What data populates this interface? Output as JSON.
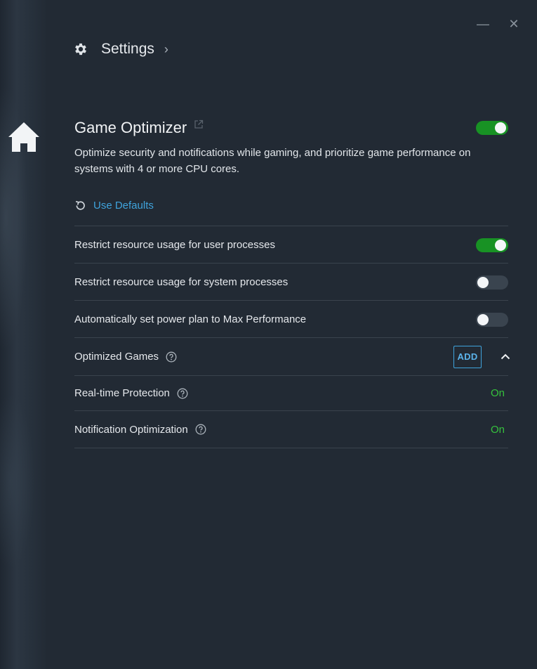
{
  "window": {
    "minimize_glyph": "—",
    "close_glyph": "✕"
  },
  "header": {
    "title": "Settings",
    "chevron": "›"
  },
  "section": {
    "title": "Game Optimizer",
    "description": "Optimize security and notifications while gaming, and prioritize game performance on systems with 4 or more CPU cores.",
    "enabled": true,
    "use_defaults_label": "Use Defaults"
  },
  "rows": [
    {
      "label": "Restrict resource usage for user processes",
      "toggle": true
    },
    {
      "label": "Restrict resource usage for system processes",
      "toggle": false
    },
    {
      "label": "Automatically set power plan to Max Performance",
      "toggle": false
    }
  ],
  "optimized_games": {
    "label": "Optimized Games",
    "add_label": "ADD"
  },
  "real_time_protection": {
    "label": "Real-time Protection",
    "status": "On"
  },
  "notification_optimization": {
    "label": "Notification Optimization",
    "status": "On"
  },
  "colors": {
    "background": "#222a34",
    "accent_blue": "#3fa3dc",
    "toggle_on": "#189224",
    "status_on": "#36c23d"
  },
  "icons": [
    "home-icon",
    "gear-icon",
    "chevron-right-icon",
    "external-link-icon",
    "reset-icon",
    "help-icon",
    "chevron-up-icon",
    "minimize-icon",
    "close-icon"
  ]
}
